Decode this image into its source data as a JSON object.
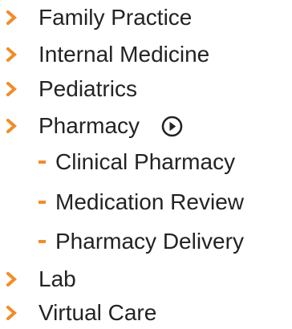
{
  "accent_color": "#f28c28",
  "text_color": "#222325",
  "menu": {
    "items": [
      {
        "label": "Family Practice",
        "icon": "chevron-right-icon"
      },
      {
        "label": "Internal Medicine",
        "icon": "chevron-right-icon"
      },
      {
        "label": "Pediatrics",
        "icon": "chevron-right-icon"
      },
      {
        "label": "Pharmacy",
        "icon": "chevron-right-icon",
        "badge_icon": "play-circle-icon"
      },
      {
        "label": "Lab",
        "icon": "chevron-right-icon"
      },
      {
        "label": "Virtual Care",
        "icon": "chevron-right-icon"
      }
    ],
    "pharmacy_subitems": [
      {
        "label": "Clinical Pharmacy",
        "icon": "dash-icon"
      },
      {
        "label": "Medication Review",
        "icon": "dash-icon"
      },
      {
        "label": "Pharmacy Delivery",
        "icon": "dash-icon"
      }
    ]
  }
}
